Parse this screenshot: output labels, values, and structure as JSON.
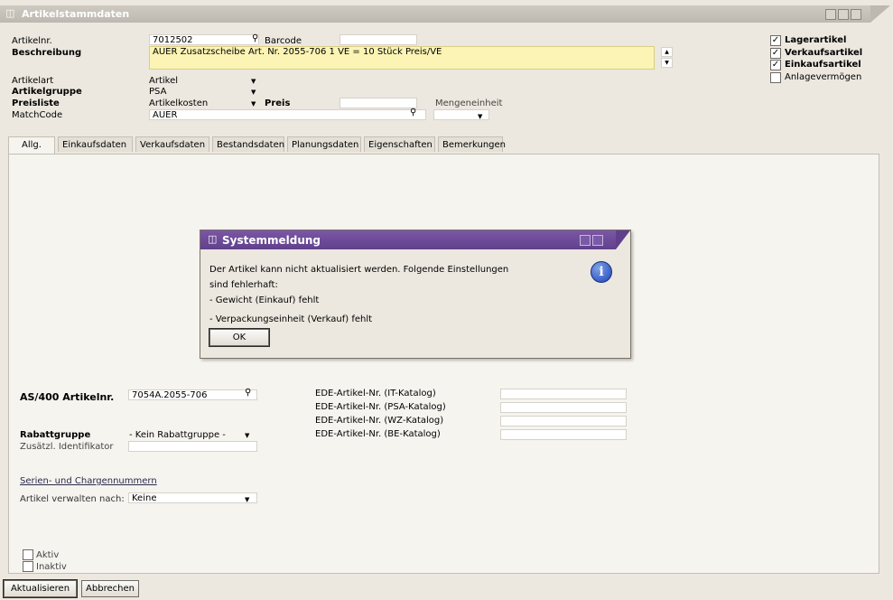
{
  "window": {
    "title": "Artikelstammdaten"
  },
  "header": {
    "artikelnr_label": "Artikelnr.",
    "artikelnr_value": "7012502",
    "barcode_label": "Barcode",
    "barcode_value": "",
    "beschreibung_label": "Beschreibung",
    "beschreibung_value": "AUER Zusatzscheibe Art. Nr. 2055-706 1 VE = 10 Stück Preis/VE",
    "artikelart_label": "Artikelart",
    "artikelart_value": "Artikel",
    "artikelgruppe_label": "Artikelgruppe",
    "artikelgruppe_value": "PSA",
    "preisliste_label": "Preisliste",
    "preisliste_value": "Artikelkosten",
    "preis_label": "Preis",
    "preis_value": "",
    "mengeneinheit_label": "Mengeneinheit",
    "matchcode_label": "MatchCode",
    "matchcode_value": "AUER"
  },
  "checkboxes": [
    {
      "label": "Lagerartikel",
      "checked": true
    },
    {
      "label": "Verkaufsartikel",
      "checked": true
    },
    {
      "label": "Einkaufsartikel",
      "checked": true
    },
    {
      "label": "Anlagevermögen",
      "checked": false
    }
  ],
  "tabs": [
    {
      "label": "Allg."
    },
    {
      "label": "Einkaufsdaten"
    },
    {
      "label": "Verkaufsdaten"
    },
    {
      "label": "Bestandsdaten"
    },
    {
      "label": "Planungsdaten"
    },
    {
      "label": "Eigenschaften"
    },
    {
      "label": "Bemerkungen"
    }
  ],
  "dialog": {
    "title": "Systemmeldung",
    "line1": "Der Artikel kann nicht aktualisiert werden. Folgende Einstellungen",
    "line2": "sind fehlerhaft:",
    "line3": "-  Gewicht (Einkauf) fehlt",
    "line4": "-  Verpackungseinheit (Verkauf) fehlt",
    "ok_label": "OK",
    "icon": "info-icon"
  },
  "general": {
    "as400_label": "AS/400 Artikelnr.",
    "as400_value": "7054A.2055-706",
    "rabattgruppe_label": "Rabattgruppe",
    "rabattgruppe_value": "- Kein Rabattgruppe -",
    "zusatz_label": "Zusätzl. Identifikator",
    "zusatz_value": "",
    "serien_link": "Serien- und Chargennummern",
    "verwalten_label": "Artikel verwalten nach:",
    "verwalten_value": "Keine",
    "ede_rows": [
      {
        "label": "EDE-Artikel-Nr. (IT-Katalog)",
        "value": ""
      },
      {
        "label": "EDE-Artikel-Nr. (PSA-Katalog)",
        "value": ""
      },
      {
        "label": "EDE-Artikel-Nr. (WZ-Katalog)",
        "value": ""
      },
      {
        "label": "EDE-Artikel-Nr. (BE-Katalog)",
        "value": ""
      }
    ],
    "aktiv_label": "Aktiv",
    "inaktiv_label": "Inaktiv"
  },
  "footer": {
    "aktualisieren_label": "Aktualisieren",
    "abbrechen_label": "Abbrechen"
  }
}
